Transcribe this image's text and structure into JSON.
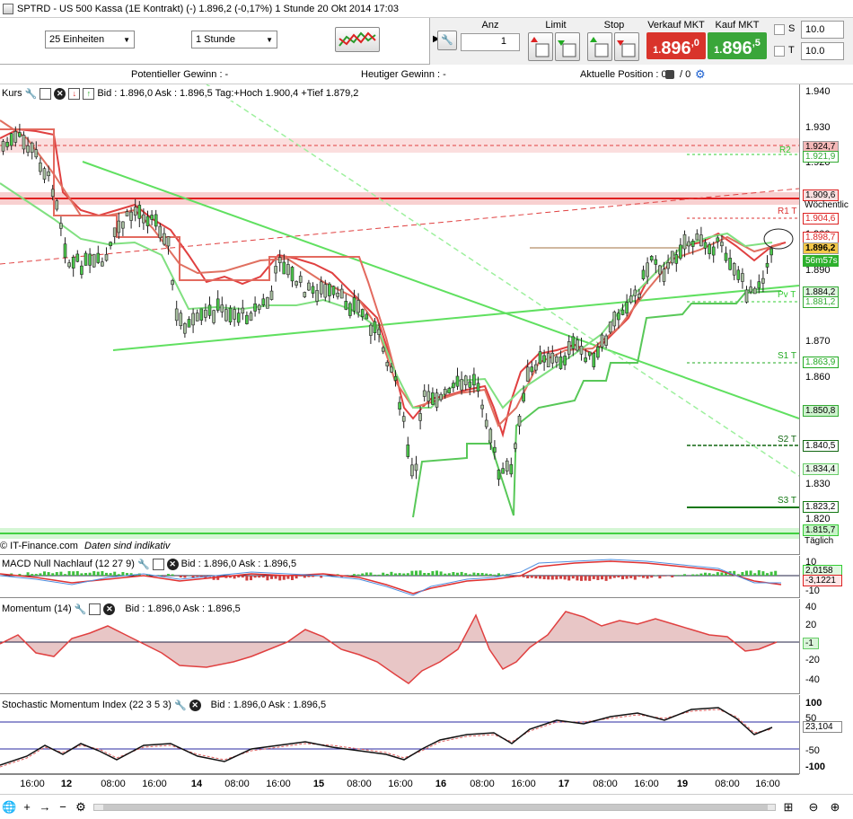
{
  "window_title": "SPTRD - US 500 Kassa (1E Kontrakt) (-)   1.896,2 (-0,17%)     1 Stunde  20 Okt 2014 17:03",
  "toolbar": {
    "units_select": "25 Einheiten",
    "interval_select": "1 Stunde",
    "anz_label": "Anz",
    "anz_value": "1",
    "limit_label": "Limit",
    "stop_label": "Stop",
    "sell_label": "Verkauf MKT",
    "buy_label": "Kauf MKT",
    "sell_price_small": "1.",
    "sell_price_big": "896",
    "sell_price_frac": ",0",
    "buy_price_small": "1.",
    "buy_price_big": "896",
    "buy_price_frac": ",5",
    "s_label": "S",
    "t_label": "T",
    "s_value": "10.0",
    "t_value": "10.0",
    "sell_color": "#d9342b",
    "buy_color": "#3aa63a"
  },
  "infobar": {
    "potential_gain": "Potentieller Gewinn : -",
    "today_gain": "Heutiger Gewinn : -",
    "current_position": "Aktuelle Position : 0",
    "position_sep": "/ 0"
  },
  "price_pane": {
    "title": "Kurs",
    "quote": "Bid : 1.896,0 Ask : 1.896,5 Tag:+Hoch 1.900,4 +Tief 1.879,2",
    "footer_brand": "© IT-Finance.com",
    "footer_note": "Daten sind indikativ",
    "axis_ticks": [
      "1.940",
      "1.930",
      "1.920",
      "1.910",
      "1.900",
      "1.890",
      "1.880",
      "1.870",
      "1.860",
      "1.850",
      "1.840",
      "1.830",
      "1.820"
    ],
    "tags": {
      "r2": "1.924,7",
      "r2b": "1.921,9",
      "weekly": "1.909,6",
      "weekly_label": "Wöchentlic",
      "r1": "1.904,6",
      "t1": "1.898,7",
      "current": "1.896,2",
      "timer": "56m57s",
      "pivot": "1.884,2",
      "pivot2": "1.881,2",
      "s1": "1.863,9",
      "trend": "1.850,8",
      "s2": "1.840,5",
      "trend2": "1.834,4",
      "s3": "1.823,2",
      "daily": "1.815,7",
      "daily_label": "Täglich"
    },
    "level_labels": {
      "r2": "R2",
      "r1": "R1 T",
      "pivot": "Pv T",
      "s1": "S1 T",
      "s2": "S2 T",
      "s3": "S3 T"
    }
  },
  "macd_pane": {
    "title": "MACD Null Nachlauf (12 27 9)",
    "quote": "Bid : 1.896,0 Ask : 1.896,5",
    "tag1": "2,0158",
    "tag2": "-3,1221",
    "tick_top": "10",
    "tick_bottom": "-10"
  },
  "momentum_pane": {
    "title": "Momentum (14)",
    "quote": "Bid : 1.896,0 Ask : 1.896,5",
    "ticks": [
      "40",
      "20",
      "-20",
      "-40"
    ],
    "tag": "-1"
  },
  "stoch_pane": {
    "title": "Stochastic Momentum Index (22 3 5 3)",
    "quote": "Bid : 1.896,0 Ask : 1.896,5",
    "ticks": [
      "100",
      "50",
      "-50",
      "-100"
    ],
    "tag": "23,104"
  },
  "time_axis": [
    {
      "label": "16:00",
      "bold": false
    },
    {
      "label": "12",
      "bold": true
    },
    {
      "label": "08:00",
      "bold": false
    },
    {
      "label": "16:00",
      "bold": false
    },
    {
      "label": "14",
      "bold": true
    },
    {
      "label": "08:00",
      "bold": false
    },
    {
      "label": "16:00",
      "bold": false
    },
    {
      "label": "15",
      "bold": true
    },
    {
      "label": "08:00",
      "bold": false
    },
    {
      "label": "16:00",
      "bold": false
    },
    {
      "label": "16",
      "bold": true
    },
    {
      "label": "08:00",
      "bold": false
    },
    {
      "label": "16:00",
      "bold": false
    },
    {
      "label": "17",
      "bold": true
    },
    {
      "label": "08:00",
      "bold": false
    },
    {
      "label": "16:00",
      "bold": false
    },
    {
      "label": "19",
      "bold": true
    },
    {
      "label": "08:00",
      "bold": false
    },
    {
      "label": "16:00",
      "bold": false
    }
  ],
  "status_icons": [
    "world-icon",
    "plus-icon",
    "arrow-right-icon",
    "minus-icon",
    "settings-icon",
    "camera-icon",
    "scroll-icon",
    "zoom-in-icon"
  ]
}
